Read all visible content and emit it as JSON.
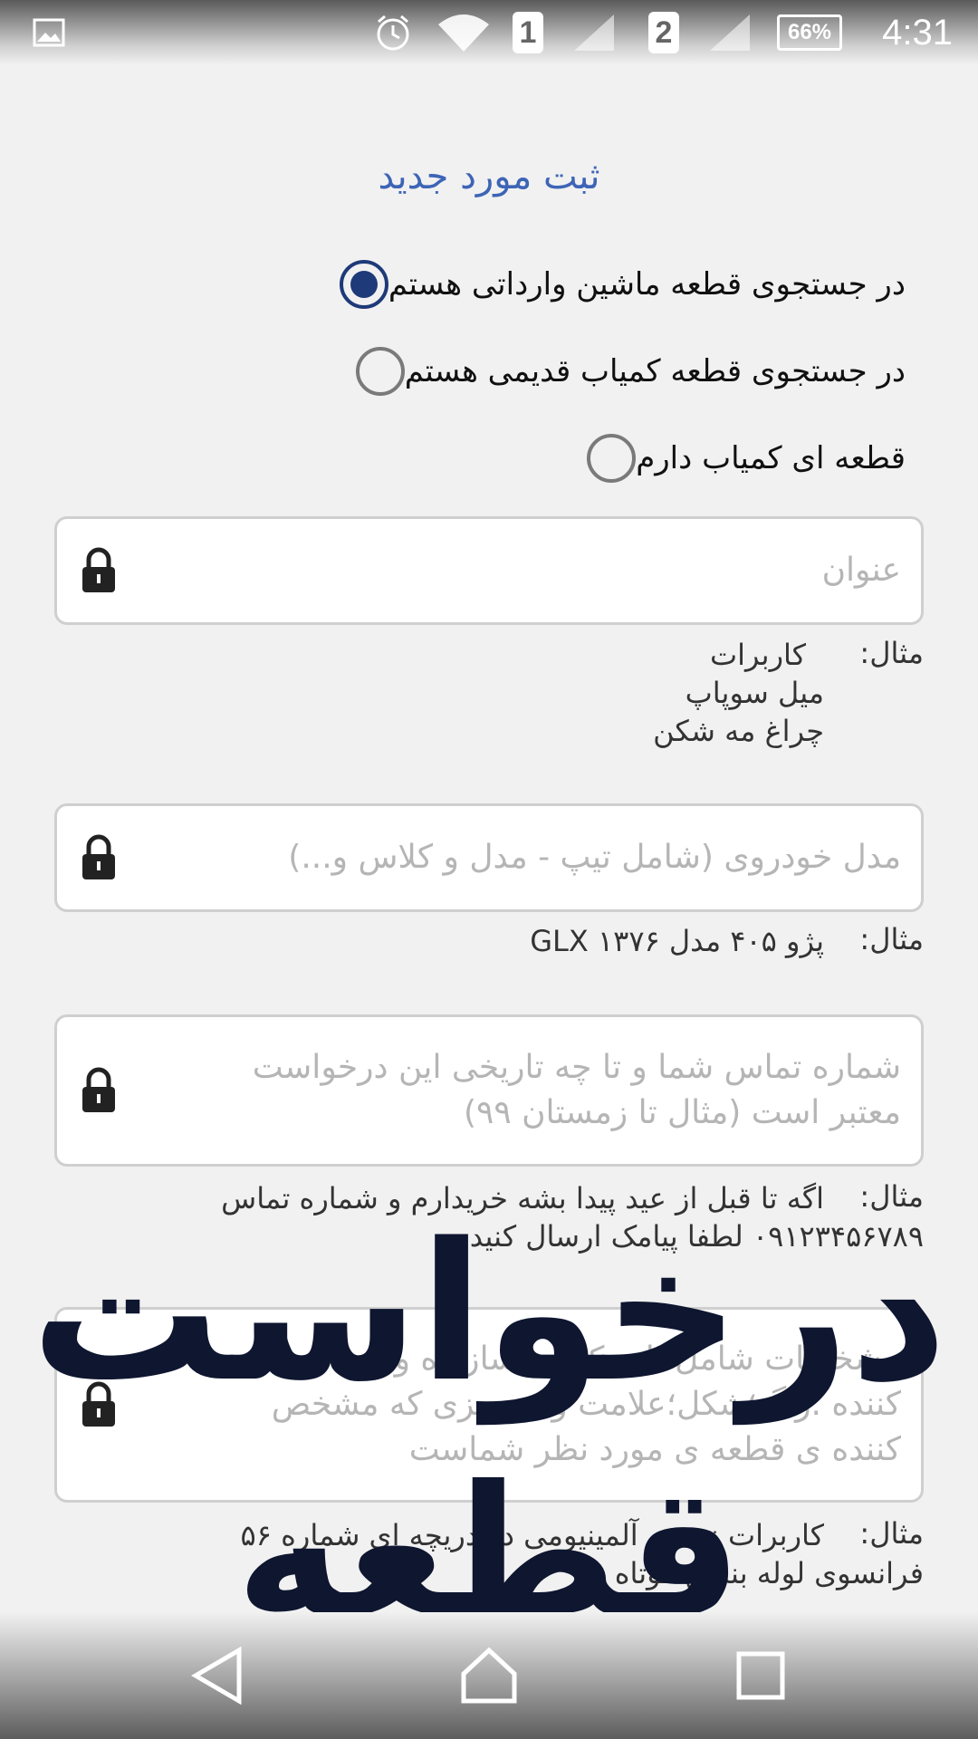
{
  "status_bar": {
    "time": "4:31",
    "battery": "66%",
    "sim1": "1",
    "sim2": "2",
    "icons": [
      "gallery-icon",
      "alarm-icon",
      "wifi-icon",
      "signal-icon",
      "battery-icon"
    ]
  },
  "page": {
    "title": "ثبت مورد جدید"
  },
  "options": [
    {
      "label": "در جستجوی قطعه ماشین وارداتی هستم",
      "checked": true
    },
    {
      "label": "در جستجوی قطعه کمیاب قدیمی هستم",
      "checked": false
    },
    {
      "label": "قطعه ای کمیاب دارم",
      "checked": false
    }
  ],
  "fields": {
    "title": {
      "placeholder": "عنوان"
    },
    "car_model": {
      "placeholder": "مدل خودروی (شامل تیپ - مدل و کلاس و...)"
    },
    "contact": {
      "placeholder_line1": "شماره تماس شما و تا چه تاریخی این درخواست",
      "placeholder_line2": "معتبر است (مثال تا زمستان ۹۹)"
    },
    "specs": {
      "placeholder_line1": "مشخصات شامل نام، کشور سازنده وارد",
      "placeholder_line2": "کننده ؛رنگ؛شکل؛علامت و هرچیزی که مشخص",
      "placeholder_line3": "کننده ی قطعه ی مورد نظر شماست"
    }
  },
  "examples": {
    "label": "مثال:",
    "title_lines": [
      "کاربرات",
      "میل سوپاپ",
      "چراغ مه شکن"
    ],
    "car_model_line": "پژو ۴۰۵ مدل ۱۳۷۶ GLX",
    "contact_lines": [
      "اگه تا قبل از عید پیدا بشه خریدارم و شماره تماس",
      "۰۹۱۲۳۴۵۶۷۸۹ لطفا پیامک ارسال کنید."
    ],
    "specs_lines": [
      "کاربرات نوشته آلمینیومی دو دریچه ای شماره ۵۶",
      "فرانسوی لوله بنزین کوتاه"
    ]
  },
  "overlay": {
    "line1": "درخواست",
    "line2": "قطعه"
  },
  "nav": {
    "icons": [
      "back-icon",
      "home-icon",
      "recents-icon"
    ]
  },
  "colors": {
    "accent": "#3d64b6",
    "radio_checked": "#1e3a78",
    "overlay_text": "#0e1630"
  }
}
